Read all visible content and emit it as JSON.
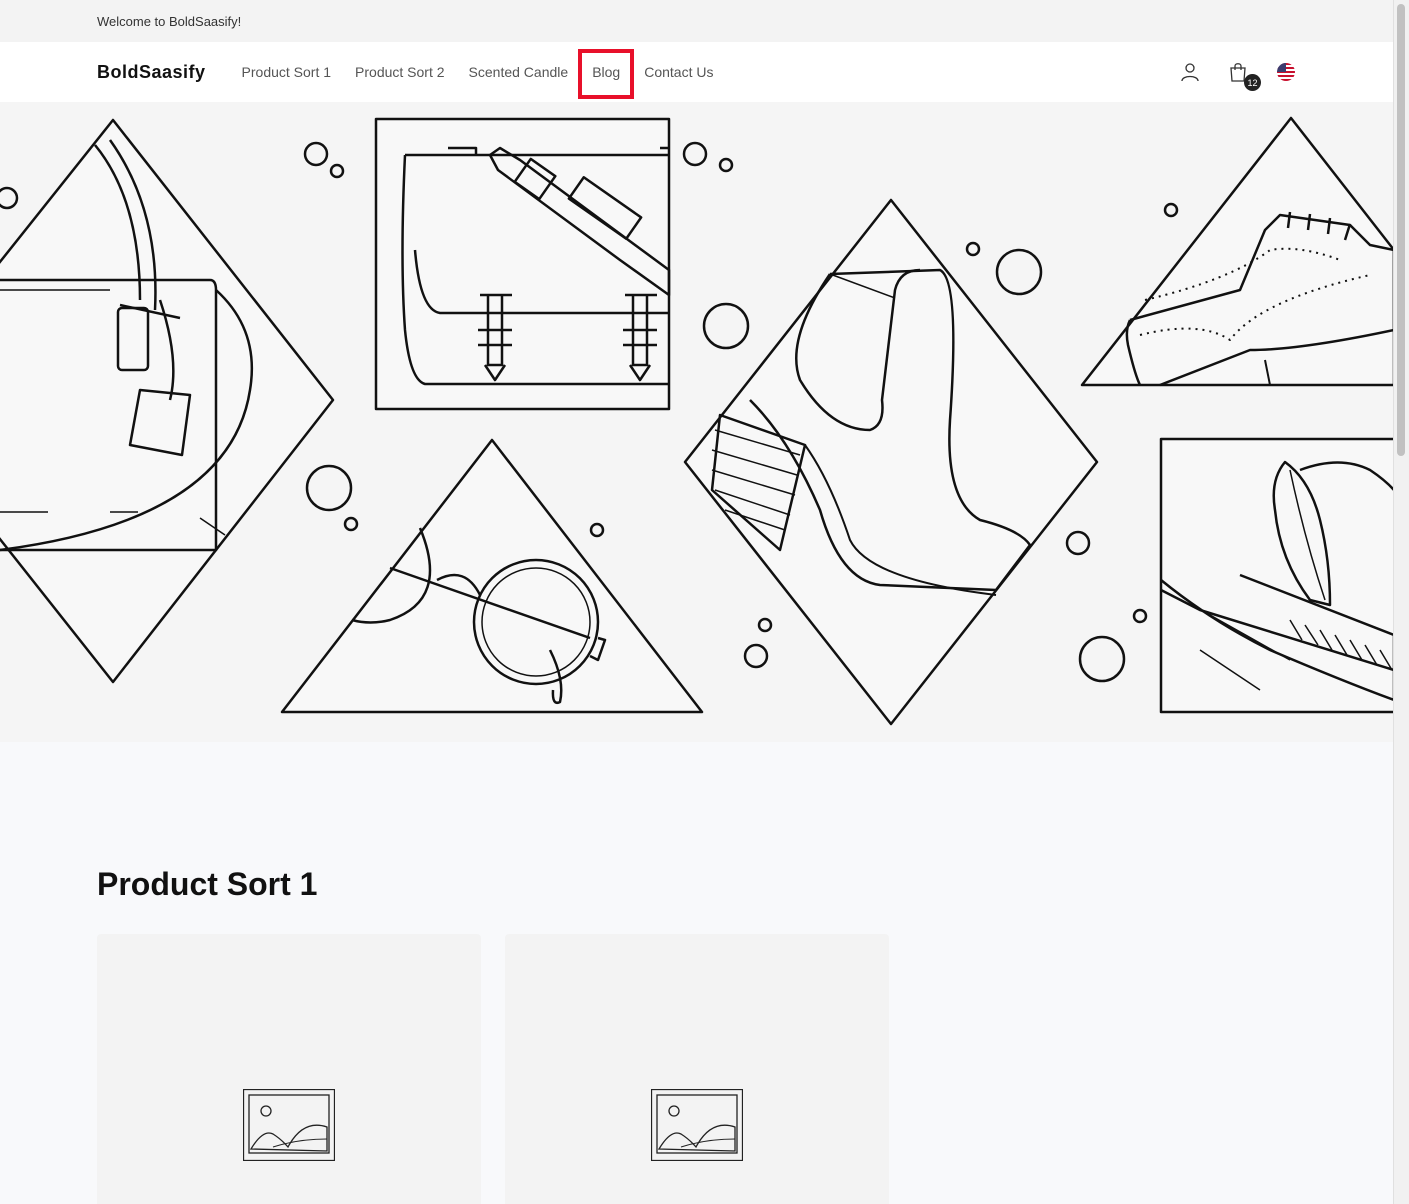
{
  "announcement": {
    "text": "Welcome to BoldSaasify!"
  },
  "header": {
    "logo": "BoldSaasify",
    "nav": [
      {
        "label": "Product Sort 1"
      },
      {
        "label": "Product Sort 2"
      },
      {
        "label": "Scented Candle"
      },
      {
        "label": "Blog"
      },
      {
        "label": "Contact Us"
      }
    ],
    "highlighted_nav": "Blog",
    "highlight_color": "#e8102a",
    "cart_count": "12",
    "icons": [
      "user-icon",
      "cart-icon",
      "us-flag-icon"
    ]
  },
  "hero": {
    "illustration_items": [
      "handbag",
      "messenger-bag",
      "eyeglasses",
      "boot",
      "brogue-shoe",
      "feather-quill"
    ]
  },
  "section": {
    "title": "Product Sort 1",
    "cards": [
      {
        "image": "image-placeholder-icon"
      },
      {
        "image": "image-placeholder-icon"
      }
    ]
  }
}
